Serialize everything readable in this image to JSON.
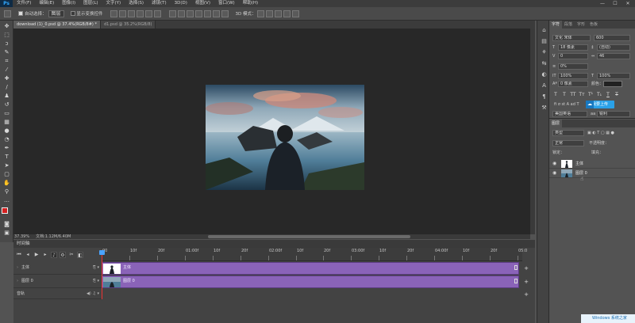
{
  "app": {
    "logo": "Ps"
  },
  "menu": [
    "文件(F)",
    "编辑(E)",
    "图像(I)",
    "图层(L)",
    "文字(Y)",
    "选择(S)",
    "滤镜(T)",
    "3D(D)",
    "视图(V)",
    "窗口(W)",
    "帮助(H)"
  ],
  "window_controls": {
    "minimize": "—",
    "maximize": "☐",
    "close": "✕"
  },
  "options": {
    "auto_select_label": "自动选择：",
    "auto_select_value": "图层",
    "show_transform_label": "显示变换控件",
    "mode_3d_label": "3D 模式："
  },
  "tabs": [
    {
      "label": "download (1)_0.psd @ 37.4%(RGB/8#) *",
      "active": true
    },
    {
      "label": "d1.psd @ 35.2%(RGB/8)",
      "active": false
    }
  ],
  "status": {
    "zoom": "37.39%",
    "doc": "文档:1.12M/6.40M"
  },
  "timeline": {
    "title": "时间轴",
    "ruler": [
      "00",
      "10f",
      "20f",
      "01:00f",
      "10f",
      "20f",
      "02:00f",
      "10f",
      "20f",
      "03:00f",
      "10f",
      "20f",
      "04:00f",
      "10f",
      "20f",
      "05:0"
    ],
    "tracks": [
      {
        "label": "主体",
        "clip": "主体"
      },
      {
        "label": "图层 0",
        "clip": "图层 0"
      }
    ],
    "audio_label": "音轨"
  },
  "character": {
    "tabs": [
      "字符",
      "段落",
      "字形",
      "色板"
    ],
    "font_family": "文化 宋体",
    "font_style": "600",
    "font_size": "18 像素",
    "leading": "(自动)",
    "kerning": "0",
    "tracking": "46",
    "vscale_pct": "0%",
    "vert_scale": "100%",
    "horiz_scale": "100%",
    "baseline": "0 像素",
    "color_label": "颜色：",
    "format_buttons": [
      "T",
      "T",
      "TT",
      "Tт",
      "T¹",
      "T₁",
      "T",
      "T"
    ],
    "share_label": "我要上传",
    "lang": "美国英语",
    "aa": "锐利"
  },
  "layers": {
    "title": "图层",
    "filter_label": "类型",
    "blend_label": "正常",
    "opacity_label": "不透明度：",
    "lock_label": "锁定：",
    "fill_label": "填充：",
    "items": [
      {
        "name": "主体",
        "visible": true
      },
      {
        "name": "图层 0",
        "visible": true
      }
    ]
  },
  "footer_brand": "Windows 系统之家"
}
